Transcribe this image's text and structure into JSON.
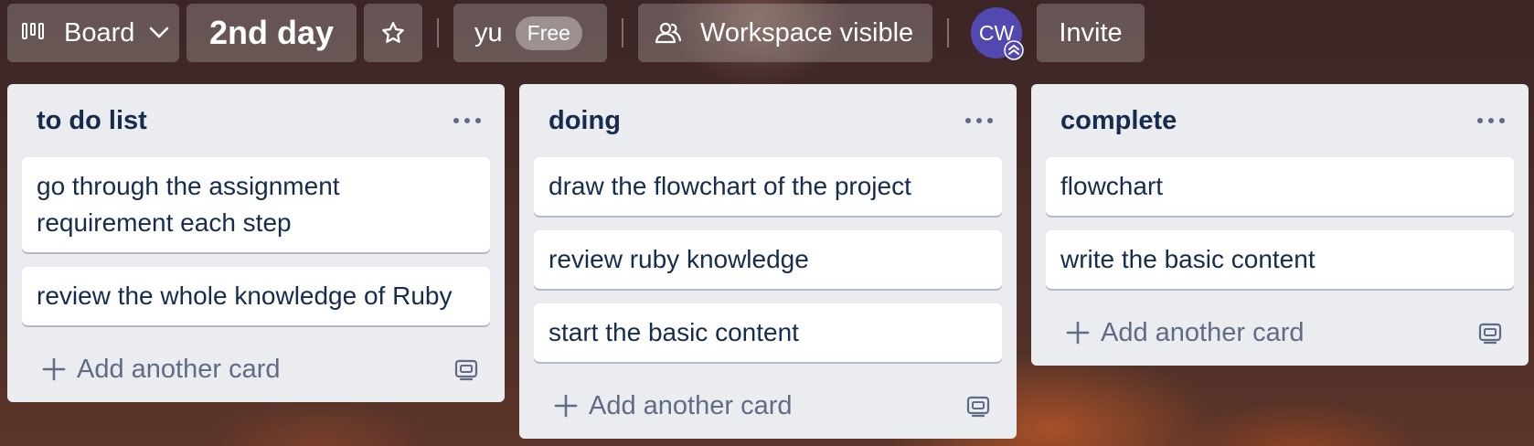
{
  "topbar": {
    "view_label": "Board",
    "board_title": "2nd day",
    "workspace_name": "yu",
    "workspace_badge": "Free",
    "visibility_label": "Workspace visible",
    "avatar_initials": "CW",
    "invite_label": "Invite",
    "icons": [
      "board-view-icon",
      "chevron-down-icon",
      "star-icon",
      "people-icon",
      "admin-badge-icon"
    ]
  },
  "lists": [
    {
      "title": "to do list",
      "cards": [
        "go through the assignment requirement each step",
        "review the whole knowledge of Ruby"
      ],
      "add_label": "Add another card"
    },
    {
      "title": "doing",
      "cards": [
        "draw the flowchart of the project",
        "review ruby knowledge",
        "start the basic content"
      ],
      "add_label": "Add another card"
    },
    {
      "title": "complete",
      "cards": [
        "flowchart",
        "write the basic content"
      ],
      "add_label": "Add another card"
    }
  ],
  "icons": {
    "list_menu": "more-horizontal-icon",
    "add": "plus-icon",
    "template": "card-template-icon"
  },
  "colors": {
    "list_bg": "#ebecf0",
    "card_text": "#172b4d",
    "muted_text": "#5e6c84",
    "avatar_bg": "#5148b0"
  }
}
